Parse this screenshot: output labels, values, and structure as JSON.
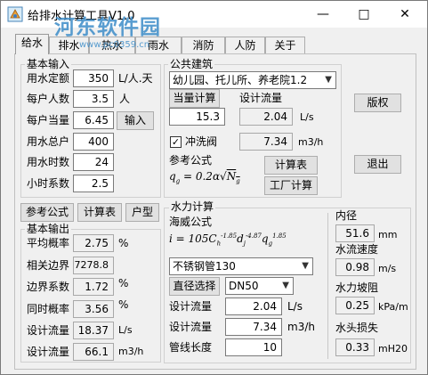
{
  "window": {
    "title": "给排水计算工具V1.0",
    "minimize_glyph": "—",
    "maximize_glyph": "□",
    "close_glyph": "✕"
  },
  "watermark": {
    "name": "河东软件园",
    "url": "www.pc0359.cn"
  },
  "tabs": [
    {
      "label": "给水"
    },
    {
      "label": "排水"
    },
    {
      "label": "热水"
    },
    {
      "label": "雨水"
    },
    {
      "label": "消防"
    },
    {
      "label": "人防"
    },
    {
      "label": "关于"
    }
  ],
  "basic_input": {
    "title": "基本输入",
    "rows": [
      {
        "label": "用水定额",
        "value": "350",
        "unit": "L/人.天"
      },
      {
        "label": "每户人数",
        "value": "3.5",
        "unit": "人"
      },
      {
        "label": "每户当量",
        "value": "6.45",
        "unit": ""
      },
      {
        "label": "用水总户",
        "value": "400",
        "unit": ""
      },
      {
        "label": "用水时数",
        "value": "24",
        "unit": ""
      },
      {
        "label": "小时系数",
        "value": "2.5",
        "unit": ""
      }
    ],
    "input_button": "输入"
  },
  "public_building": {
    "title": "公共建筑",
    "building_type": "幼儿园、托儿所、养老院1.2",
    "equiv_button": "当量计算",
    "equiv_value": "15.3",
    "design_flow_label": "设计流量",
    "design_flow_ls": "2.04",
    "unit_ls": "L/s",
    "flush_valve_label": "冲洗阀",
    "flush_valve_checked": true,
    "design_flow_m3h": "7.34",
    "unit_m3h": "m3/h",
    "ref_formula_label": "参考公式",
    "calc_table_button": "计算表",
    "factory_calc_button": "工厂计算"
  },
  "side_buttons": {
    "copyright": "版权",
    "exit": "退出"
  },
  "bottom_buttons": {
    "ref_formula": "参考公式",
    "calc_table": "计算表",
    "house_type": "户型"
  },
  "basic_output": {
    "title": "基本输出",
    "rows": [
      {
        "label": "平均概率",
        "value": "2.75",
        "unit": "%"
      },
      {
        "label": "相关边界",
        "value": "7278.8",
        "unit": ""
      },
      {
        "label": "边界系数",
        "value": "1.72",
        "unit": "%"
      },
      {
        "label": "同时概率",
        "value": "3.56",
        "unit": "%"
      },
      {
        "label": "设计流量",
        "value": "18.37",
        "unit": "L/s"
      },
      {
        "label": "设计流量",
        "value": "66.1",
        "unit": "m3/h"
      }
    ]
  },
  "hydraulic": {
    "title": "水力计算",
    "formula_label": "海威公式",
    "pipe_material": "不锈钢管130",
    "diameter_button": "直径选择",
    "diameter_select": "DN50",
    "rows": [
      {
        "label": "设计流量",
        "value": "2.04",
        "unit": "L/s"
      },
      {
        "label": "设计流量",
        "value": "7.34",
        "unit": "m3/h"
      },
      {
        "label": "管线长度",
        "value": "10",
        "unit": ""
      }
    ],
    "inner_diameter_label": "内径",
    "inner_diameter_value": "51.6",
    "inner_diameter_unit": "mm",
    "velocity_label": "水流速度",
    "velocity_value": "0.98",
    "velocity_unit": "m/s",
    "gradient_label": "水力坡阻",
    "gradient_value": "0.25",
    "gradient_unit": "kPa/m",
    "head_loss_label": "水头损失",
    "head_loss_value": "0.33",
    "head_loss_unit": "mH20"
  }
}
